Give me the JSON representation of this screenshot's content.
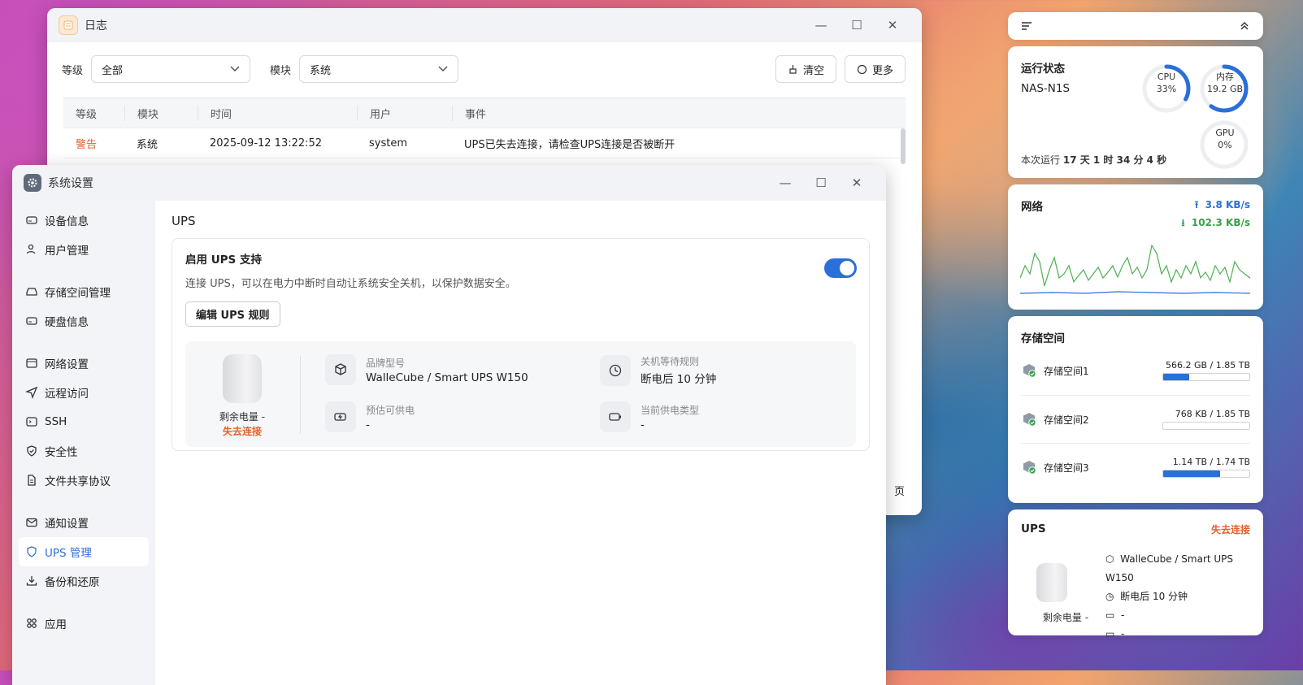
{
  "log_window": {
    "title": "日志",
    "level_label": "等级",
    "level_value": "全部",
    "module_label": "模块",
    "module_value": "系统",
    "clear_label": "清空",
    "more_label": "更多",
    "columns": [
      "等级",
      "模块",
      "时间",
      "用户",
      "事件"
    ],
    "rows": [
      {
        "level": "警告",
        "module": "系统",
        "time": "2025-09-12 13:22:52",
        "user": "system",
        "event": "UPS已失去连接，请检查UPS连接是否被断开"
      }
    ],
    "page_suffix": "页",
    "warning_color": "#e0622c"
  },
  "settings_window": {
    "title": "系统设置",
    "nav": [
      "设备信息",
      "用户管理",
      "存储空间管理",
      "硬盘信息",
      "网络设置",
      "远程访问",
      "SSH",
      "安全性",
      "文件共享协议",
      "通知设置",
      "UPS 管理",
      "备份和还原",
      "应用"
    ],
    "active_nav": "UPS 管理",
    "page_title": "UPS",
    "enable_title": "启用 UPS 支持",
    "enable_desc": "连接 UPS，可以在电力中断时自动让系统安全关机，以保护数据安全。",
    "edit_rules_label": "编辑 UPS 规则",
    "battery_label": "剩余电量 -",
    "status": "失去连接",
    "brand_key": "品牌型号",
    "brand_value": "WalleCube / Smart UPS W150",
    "shutdown_key": "关机等待规则",
    "shutdown_value": "断电后 10 分钟",
    "runtime_key": "预估可供电",
    "runtime_value": "-",
    "power_type_key": "当前供电类型",
    "power_type_value": "-",
    "accent_color": "#2b6fd8"
  },
  "status_widget": {
    "title": "运行状态",
    "device": "NAS-N1S",
    "cpu_label": "CPU",
    "cpu_value": "33%",
    "cpu_percent": 33,
    "mem_label": "内存",
    "mem_value": "19.2 GB",
    "mem_percent": 60,
    "gpu_label": "GPU",
    "gpu_value": "0%",
    "gpu_percent": 0,
    "uptime_prefix": "本次运行",
    "uptime_value": "17 天 1 时 34 分 4 秒"
  },
  "network_widget": {
    "title": "网络",
    "upload": "3.8 KB/s",
    "download": "102.3 KB/s",
    "upload_color": "#2b6fd8",
    "download_color": "#3aa04a"
  },
  "storage_widget": {
    "title": "存储空间",
    "volumes": [
      {
        "name": "存储空间1",
        "usage": "566.2 GB / 1.85 TB",
        "fraction": 0.3
      },
      {
        "name": "存储空间2",
        "usage": "768 KB / 1.85 TB",
        "fraction": 0.0
      },
      {
        "name": "存储空间3",
        "usage": "1.14 TB / 1.74 TB",
        "fraction": 0.66
      }
    ]
  },
  "ups_widget": {
    "title": "UPS",
    "status": "失去连接",
    "brand": "WalleCube / Smart UPS W150",
    "shutdown": "断电后 10 分钟",
    "runtime": "-",
    "power_type": "-",
    "battery_label": "剩余电量 -"
  }
}
